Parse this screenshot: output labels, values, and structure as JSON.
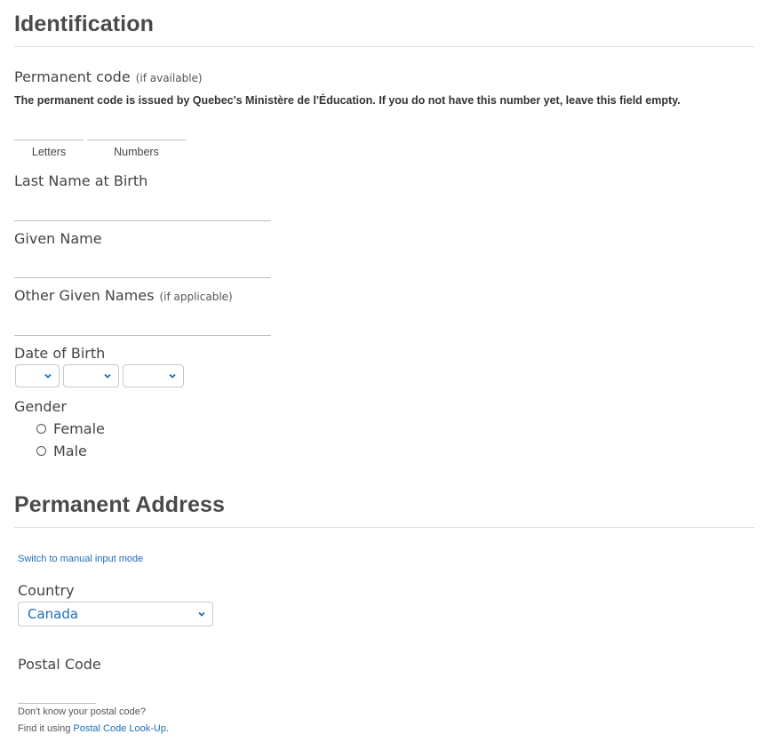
{
  "identification": {
    "title": "Identification",
    "permanent_code": {
      "label": "Permanent code",
      "hint": "(if available)",
      "note": "The permanent code is issued by Quebec's Ministère de l'Éducation. If you do not have this number yet, leave this field empty.",
      "letters_label": "Letters",
      "numbers_label": "Numbers",
      "letters_value": "",
      "numbers_value": ""
    },
    "last_name": {
      "label": "Last Name at Birth",
      "value": ""
    },
    "given_name": {
      "label": "Given Name",
      "value": ""
    },
    "other_given_names": {
      "label": "Other Given Names",
      "hint": "(if applicable)",
      "value": ""
    },
    "date_of_birth": {
      "label": "Date of Birth",
      "day_value": "",
      "month_value": "",
      "year_value": ""
    },
    "gender": {
      "label": "Gender",
      "options": [
        {
          "label": "Female",
          "selected": false
        },
        {
          "label": "Male",
          "selected": false
        }
      ]
    }
  },
  "address": {
    "title": "Permanent Address",
    "manual_mode_link": "Switch to manual input mode",
    "country": {
      "label": "Country",
      "selected": "Canada"
    },
    "postal_code": {
      "label": "Postal Code",
      "value": "",
      "help_line1": "Don't know your postal code?",
      "help_prefix": "Find it using ",
      "help_link": "Postal Code Look-Up",
      "help_suffix": "."
    }
  },
  "colors": {
    "heading": "#4a4a4a",
    "link": "#1b6fb8",
    "select_text": "#1b6fb8",
    "rule": "#dcdcdc"
  }
}
